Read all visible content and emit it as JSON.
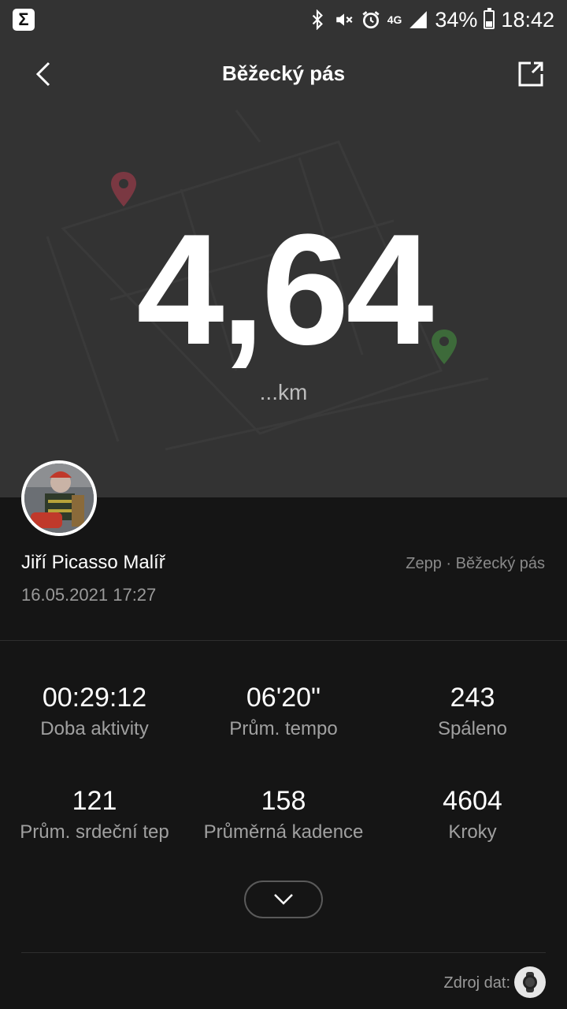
{
  "statusbar": {
    "battery": "34%",
    "time": "18:42",
    "network": "4G"
  },
  "header": {
    "title": "Běžecký pás"
  },
  "hero": {
    "distance": "4,64",
    "unit": "...km"
  },
  "user": {
    "name": "Jiří Picasso Malíř",
    "datetime": "16.05.2021 17:27",
    "source": "Zepp · Běžecký pás"
  },
  "stats": [
    {
      "value": "00:29:12",
      "label": "Doba aktivity"
    },
    {
      "value": "06'20\"",
      "label": "Prům. tempo"
    },
    {
      "value": "243",
      "label": "Spáleno"
    },
    {
      "value": "121",
      "label": "Prům. srdeční tep"
    },
    {
      "value": "158",
      "label": "Průměrná kadence"
    },
    {
      "value": "4604",
      "label": "Kroky"
    }
  ],
  "footer": {
    "data_source_label": "Zdroj dat:"
  },
  "colors": {
    "hero_bg": "#333333",
    "body_bg": "#151515",
    "start_pin": "#8a3a44",
    "end_pin": "#3d6a3a"
  }
}
